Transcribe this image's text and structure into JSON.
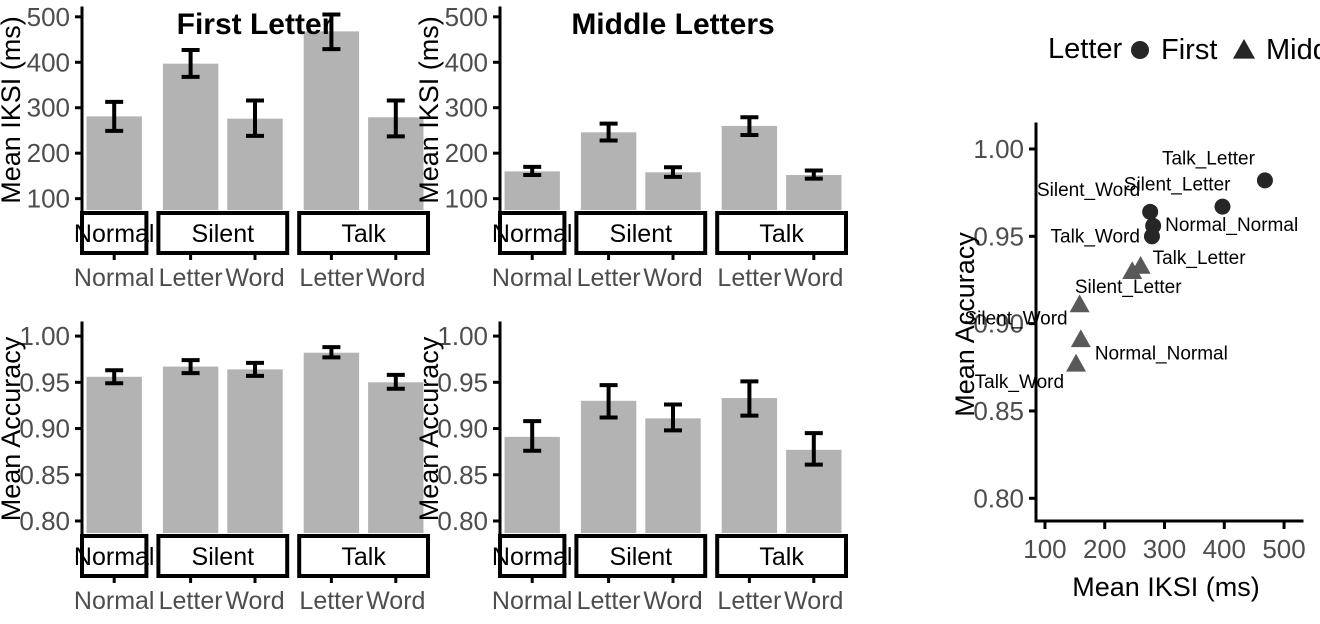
{
  "figure": {
    "background": "#ffffff",
    "bar_fill": "#b3b3b3",
    "point_first_color": "#262626",
    "point_middle_color": "#595959"
  },
  "chart_data": [
    {
      "id": "first_letter_iksi",
      "type": "bar",
      "title": "First Letter",
      "xlabel": "",
      "ylabel": "Mean IKSI (ms)",
      "ylim": [
        75,
        515
      ],
      "yticks": [
        100,
        200,
        300,
        400,
        500
      ],
      "ytick_labels": [
        "100",
        "200",
        "300",
        "400",
        "500"
      ],
      "grid": false,
      "strips": [
        "Normal",
        "Silent",
        "Talk"
      ],
      "categories": [
        "Normal",
        "Letter",
        "Word",
        "Letter",
        "Word"
      ],
      "groups": [
        {
          "strip": "Normal",
          "bars": [
            {
              "x": "Normal",
              "value": 281,
              "lower": 249,
              "upper": 313
            }
          ]
        },
        {
          "strip": "Silent",
          "bars": [
            {
              "x": "Letter",
              "value": 397,
              "lower": 368,
              "upper": 427
            },
            {
              "x": "Word",
              "value": 276,
              "lower": 238,
              "upper": 316
            }
          ]
        },
        {
          "strip": "Talk",
          "bars": [
            {
              "x": "Letter",
              "value": 468,
              "lower": 429,
              "upper": 505
            },
            {
              "x": "Word",
              "value": 279,
              "lower": 237,
              "upper": 316
            }
          ]
        }
      ]
    },
    {
      "id": "middle_letters_iksi",
      "type": "bar",
      "title": "Middle Letters",
      "xlabel": "",
      "ylabel": "Mean IKSI (ms)",
      "ylim": [
        75,
        515
      ],
      "yticks": [
        100,
        200,
        300,
        400,
        500
      ],
      "ytick_labels": [
        "100",
        "200",
        "300",
        "400",
        "500"
      ],
      "grid": false,
      "strips": [
        "Normal",
        "Silent",
        "Talk"
      ],
      "categories": [
        "Normal",
        "Letter",
        "Word",
        "Letter",
        "Word"
      ],
      "groups": [
        {
          "strip": "Normal",
          "bars": [
            {
              "x": "Normal",
              "value": 160,
              "lower": 152,
              "upper": 170
            }
          ]
        },
        {
          "strip": "Silent",
          "bars": [
            {
              "x": "Letter",
              "value": 246,
              "lower": 228,
              "upper": 265
            },
            {
              "x": "Word",
              "value": 158,
              "lower": 148,
              "upper": 169
            }
          ]
        },
        {
          "strip": "Talk",
          "bars": [
            {
              "x": "Letter",
              "value": 260,
              "lower": 240,
              "upper": 279
            },
            {
              "x": "Word",
              "value": 152,
              "lower": 144,
              "upper": 162
            }
          ]
        }
      ]
    },
    {
      "id": "first_letter_accuracy",
      "type": "bar",
      "title": "",
      "xlabel": "",
      "ylabel": "Mean Accuracy",
      "ylim": [
        0.787,
        1.012
      ],
      "yticks": [
        0.8,
        0.85,
        0.9,
        0.95,
        1.0
      ],
      "ytick_labels": [
        "0.80",
        "0.85",
        "0.90",
        "0.95",
        "1.00"
      ],
      "grid": false,
      "strips": [
        "Normal",
        "Silent",
        "Talk"
      ],
      "categories": [
        "Normal",
        "Letter",
        "Word",
        "Letter",
        "Word"
      ],
      "groups": [
        {
          "strip": "Normal",
          "bars": [
            {
              "x": "Normal",
              "value": 0.956,
              "lower": 0.949,
              "upper": 0.963
            }
          ]
        },
        {
          "strip": "Silent",
          "bars": [
            {
              "x": "Letter",
              "value": 0.967,
              "lower": 0.96,
              "upper": 0.974
            },
            {
              "x": "Word",
              "value": 0.964,
              "lower": 0.957,
              "upper": 0.971
            }
          ]
        },
        {
          "strip": "Talk",
          "bars": [
            {
              "x": "Letter",
              "value": 0.982,
              "lower": 0.977,
              "upper": 0.988
            },
            {
              "x": "Word",
              "value": 0.95,
              "lower": 0.943,
              "upper": 0.958
            }
          ]
        }
      ]
    },
    {
      "id": "middle_letters_accuracy",
      "type": "bar",
      "title": "",
      "xlabel": "",
      "ylabel": "Mean Accuracy",
      "ylim": [
        0.787,
        1.012
      ],
      "yticks": [
        0.8,
        0.85,
        0.9,
        0.95,
        1.0
      ],
      "ytick_labels": [
        "0.80",
        "0.85",
        "0.90",
        "0.95",
        "1.00"
      ],
      "grid": false,
      "strips": [
        "Normal",
        "Silent",
        "Talk"
      ],
      "categories": [
        "Normal",
        "Letter",
        "Word",
        "Letter",
        "Word"
      ],
      "groups": [
        {
          "strip": "Normal",
          "bars": [
            {
              "x": "Normal",
              "value": 0.891,
              "lower": 0.876,
              "upper": 0.908
            }
          ]
        },
        {
          "strip": "Silent",
          "bars": [
            {
              "x": "Letter",
              "value": 0.93,
              "lower": 0.912,
              "upper": 0.947
            },
            {
              "x": "Word",
              "value": 0.911,
              "lower": 0.898,
              "upper": 0.926
            }
          ]
        },
        {
          "strip": "Talk",
          "bars": [
            {
              "x": "Letter",
              "value": 0.933,
              "lower": 0.914,
              "upper": 0.951
            },
            {
              "x": "Word",
              "value": 0.877,
              "lower": 0.861,
              "upper": 0.895
            }
          ]
        }
      ]
    },
    {
      "id": "scatter_accuracy_vs_iksi",
      "type": "scatter",
      "title": "",
      "xlabel": "Mean IKSI (ms)",
      "ylabel": "Mean Accuracy",
      "xlim": [
        85,
        520
      ],
      "ylim": [
        0.787,
        1.012
      ],
      "xticks": [
        100,
        200,
        300,
        400,
        500
      ],
      "xtick_labels": [
        "100",
        "200",
        "300",
        "400",
        "500"
      ],
      "yticks": [
        0.8,
        0.85,
        0.9,
        0.95,
        1.0
      ],
      "ytick_labels": [
        "0.80",
        "0.85",
        "0.90",
        "0.95",
        "1.00"
      ],
      "grid": false,
      "legend": {
        "title": "Letter",
        "position": "top",
        "entries": [
          {
            "label": "First",
            "marker": "circle"
          },
          {
            "label": "Middle",
            "marker": "triangle"
          }
        ]
      },
      "series": [
        {
          "name": "First",
          "marker": "circle",
          "points": [
            {
              "label": "Talk_Letter",
              "x": 468,
              "y": 0.982,
              "label_dx": -10,
              "label_dy": -16,
              "label_anchor": "end"
            },
            {
              "label": "Silent_Letter",
              "x": 397,
              "y": 0.967,
              "label_dx": 8,
              "label_dy": -16,
              "label_anchor": "end"
            },
            {
              "label": "Silent_Word",
              "x": 276,
              "y": 0.964,
              "label_dx": -10,
              "label_dy": -16,
              "label_anchor": "end"
            },
            {
              "label": "Normal_Normal",
              "x": 281,
              "y": 0.956,
              "label_dx": 12,
              "label_dy": 5,
              "label_anchor": "start"
            },
            {
              "label": "Talk_Word",
              "x": 279,
              "y": 0.95,
              "label_dx": -12,
              "label_dy": 6,
              "label_anchor": "end"
            }
          ]
        },
        {
          "name": "Middle",
          "marker": "triangle",
          "points": [
            {
              "label": "Talk_Letter",
              "x": 260,
              "y": 0.933,
              "label_dx": 12,
              "label_dy": -2,
              "label_anchor": "start"
            },
            {
              "label": "Silent_Letter",
              "x": 246,
              "y": 0.93,
              "label_dx": -4,
              "label_dy": 22,
              "label_anchor": "middle"
            },
            {
              "label": "Silent_Word",
              "x": 158,
              "y": 0.911,
              "label_dx": -12,
              "label_dy": 20,
              "label_anchor": "end"
            },
            {
              "label": "Normal_Normal",
              "x": 160,
              "y": 0.891,
              "label_dx": 14,
              "label_dy": 20,
              "label_anchor": "start"
            },
            {
              "label": "Talk_Word",
              "x": 152,
              "y": 0.877,
              "label_dx": -12,
              "label_dy": 24,
              "label_anchor": "end"
            }
          ]
        }
      ]
    }
  ]
}
